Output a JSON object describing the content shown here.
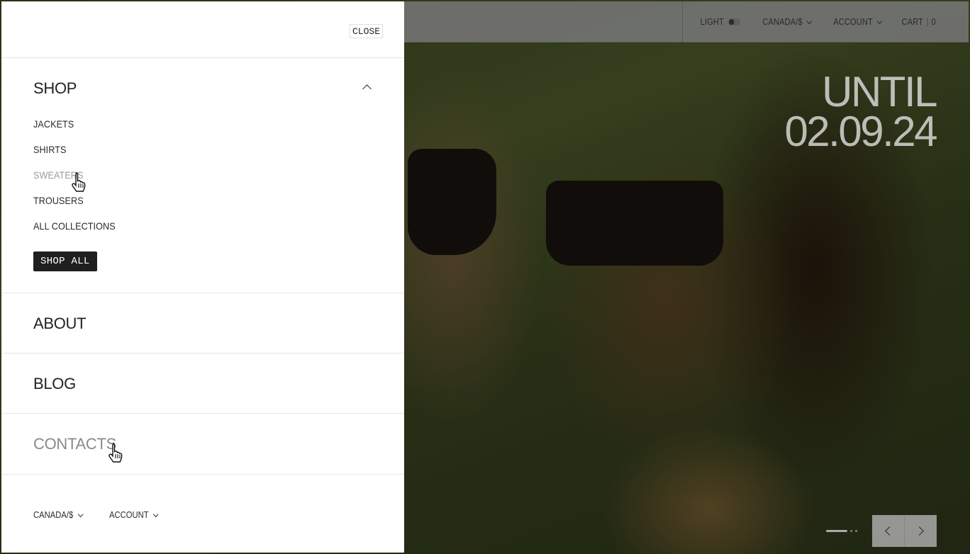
{
  "header": {
    "theme_label": "LIGHT",
    "region_label": "CANADA/$",
    "account_label": "ACCOUNT",
    "cart_label": "CART",
    "cart_count": "0"
  },
  "hero": {
    "line1": "UNTIL",
    "line2": "02.09.24"
  },
  "menu": {
    "close_label": "CLOSE",
    "shop": {
      "title": "SHOP",
      "items": [
        "JACKETS",
        "SHIRTS",
        "SWEATERS",
        "TROUSERS",
        "ALL COLLECTIONS"
      ],
      "cta": "SHOP ALL"
    },
    "about_title": "ABOUT",
    "blog_title": "BLOG",
    "contacts_title": "CONTACTS",
    "footer": {
      "region_label": "CANADA/$",
      "account_label": "ACCOUNT"
    }
  },
  "slider": {
    "slide_count": 3,
    "active_index": 0
  },
  "icons": {
    "toggle": "toggle-icon",
    "chevron": "chevron-down-icon",
    "chevron_up": "chevron-up-icon",
    "prev": "arrow-left-icon",
    "next": "arrow-right-icon",
    "cursor": "hand-cursor-icon"
  }
}
